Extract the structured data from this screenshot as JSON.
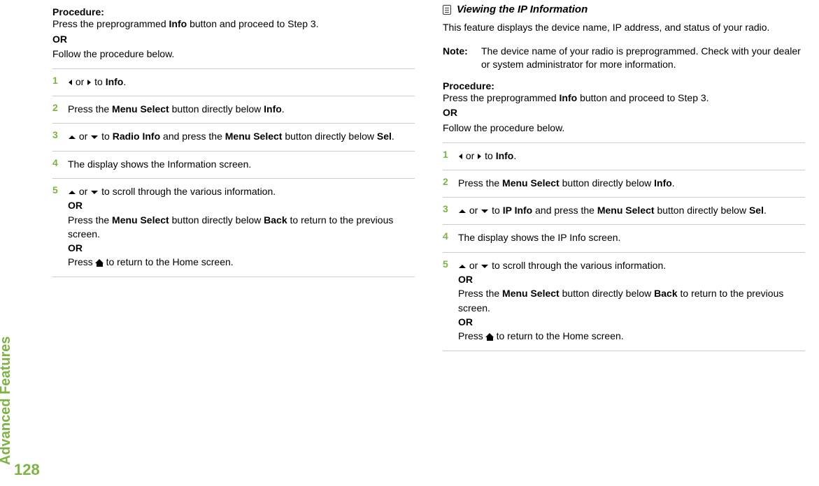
{
  "sidebar_label": "Advanced Features",
  "page_number": "128",
  "left": {
    "proc_label": "Procedure:",
    "proc_line1_a": "Press the preprogrammed ",
    "proc_line1_b": "Info",
    "proc_line1_c": " button and proceed to Step 3.",
    "proc_or": "OR",
    "proc_line2": "Follow the procedure below.",
    "steps": {
      "s1": {
        "num": "1",
        "or": " or ",
        "to": " to ",
        "info": "Info",
        "dot": "."
      },
      "s2": {
        "num": "2",
        "a": "Press the ",
        "b": "Menu Select",
        "c": " button directly below ",
        "d": "Info",
        "e": "."
      },
      "s3": {
        "num": "3",
        "or": " or ",
        "to": " to ",
        "radio_info": "Radio Info",
        "a": " and press the ",
        "b": "Menu Select",
        "c": " button directly below ",
        "sel": "Sel",
        "e": "."
      },
      "s4": {
        "num": "4",
        "a": "The display shows the Information screen."
      },
      "s5": {
        "num": "5",
        "or1": " or ",
        "a": " to scroll through the various information.",
        "or_label1": "OR",
        "b1": "Press the ",
        "b2": "Menu Select",
        "b3": " button directly below ",
        "back": "Back",
        "b4": " to return to the previous screen.",
        "or_label2": "OR",
        "c1": "Press ",
        "c2": " to return to the Home screen."
      }
    }
  },
  "right": {
    "heading": "Viewing the IP Information",
    "intro": "This feature displays the device name, IP address, and status of your radio.",
    "note_label": "Note:",
    "note_body": "The device name of your radio is preprogrammed. Check with your dealer or system administrator for more information.",
    "proc_label": "Procedure:",
    "proc_line1_a": "Press the preprogrammed ",
    "proc_line1_b": "Info",
    "proc_line1_c": " button and proceed to Step 3.",
    "proc_or": "OR",
    "proc_line2": "Follow the procedure below.",
    "steps": {
      "s1": {
        "num": "1",
        "or": " or ",
        "to": " to ",
        "info": "Info",
        "dot": "."
      },
      "s2": {
        "num": "2",
        "a": "Press the ",
        "b": "Menu Select",
        "c": " button directly below ",
        "d": "Info",
        "e": "."
      },
      "s3": {
        "num": "3",
        "or": " or ",
        "to": " to ",
        "ip_info": "IP Info",
        "a": " and press the ",
        "b": "Menu Select",
        "c": " button directly below ",
        "sel": "Sel",
        "e": "."
      },
      "s4": {
        "num": "4",
        "a": "The display shows the IP Info screen."
      },
      "s5": {
        "num": "5",
        "or1": " or ",
        "a": " to scroll through the various information.",
        "or_label1": "OR",
        "b1": "Press the ",
        "b2": "Menu Select",
        "b3": " button directly below ",
        "back": "Back",
        "b4": " to return to the previous screen.",
        "or_label2": "OR",
        "c1": "Press ",
        "c2": " to return to the Home screen."
      }
    }
  }
}
